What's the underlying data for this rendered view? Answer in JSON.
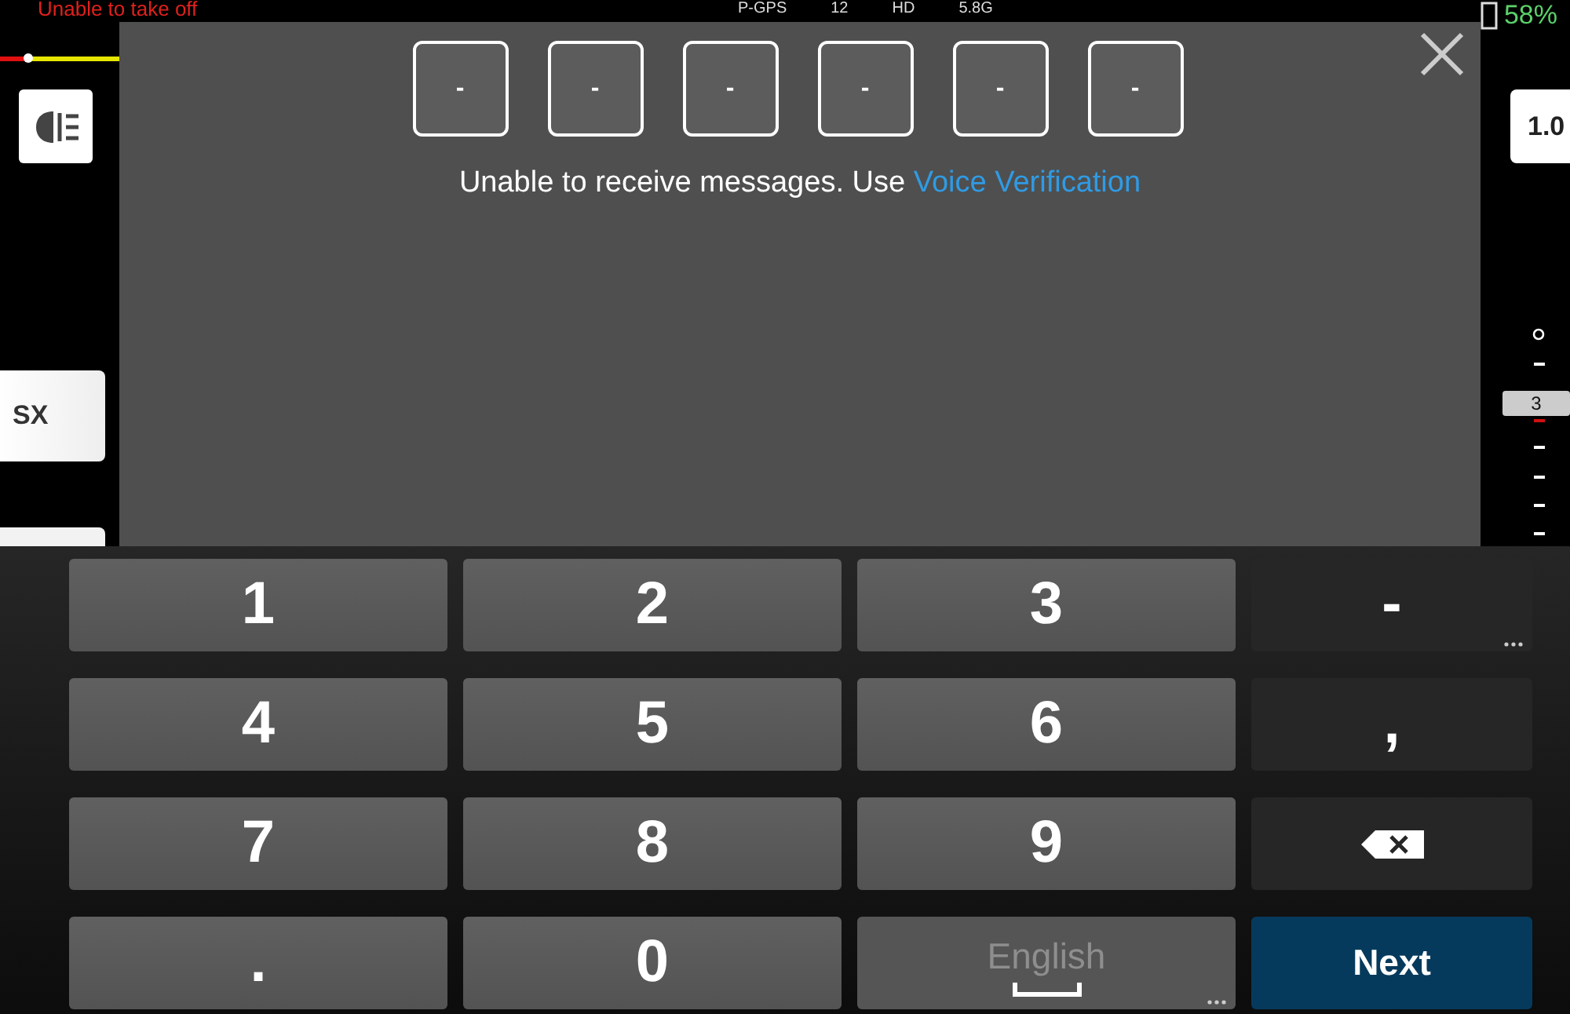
{
  "hud": {
    "warning": "Unable to take off",
    "status_items": [
      "P-GPS",
      "12",
      "HD",
      "5.8G"
    ],
    "battery": "58%",
    "left_card": "SX",
    "slider": {
      "level": 0.24
    },
    "right_card": "1.0",
    "scale_marker": "3"
  },
  "dialog": {
    "code_boxes": [
      "-",
      "-",
      "-",
      "-",
      "-",
      "-"
    ],
    "message": "Unable to receive messages. Use",
    "link": "Voice Verification"
  },
  "keyboard": {
    "keys": [
      {
        "label": "1",
        "kind": "digit"
      },
      {
        "label": "2",
        "kind": "digit"
      },
      {
        "label": "3",
        "kind": "digit"
      },
      {
        "label": "-",
        "kind": "symbol",
        "more": true
      },
      {
        "label": "4",
        "kind": "digit"
      },
      {
        "label": "5",
        "kind": "digit"
      },
      {
        "label": "6",
        "kind": "digit"
      },
      {
        "label": ",",
        "kind": "symbol",
        "more": false
      },
      {
        "label": "7",
        "kind": "digit"
      },
      {
        "label": "8",
        "kind": "digit"
      },
      {
        "label": "9",
        "kind": "digit"
      },
      {
        "kind": "backspace"
      },
      {
        "label": ".",
        "kind": "digit"
      },
      {
        "label": "0",
        "kind": "digit"
      },
      {
        "label": "English",
        "kind": "space",
        "more": true
      },
      {
        "label": "Next",
        "kind": "action"
      }
    ]
  }
}
